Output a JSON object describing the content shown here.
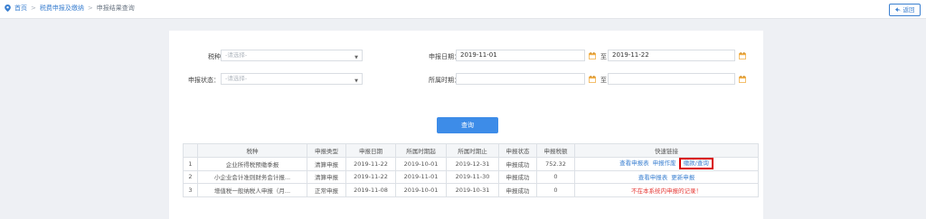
{
  "breadcrumb": {
    "home": "首页",
    "level1": "税费申报及缴纳",
    "current": "申报结果查询",
    "sep": ">"
  },
  "back_button": {
    "label": "返回"
  },
  "filters": {
    "tax_type": {
      "label": "税种：",
      "placeholder": "-请选择-"
    },
    "declare_status": {
      "label": "申报状态：",
      "placeholder": "-请选择-"
    },
    "declare_date": {
      "label": "申报日期：",
      "from": "2019-11-01",
      "to_label": "至",
      "to": "2019-11-22"
    },
    "belong_period": {
      "label": "所属时期：",
      "from": "",
      "to_label": "至",
      "to": ""
    }
  },
  "search_button": {
    "label": "查询"
  },
  "table": {
    "headers": [
      "",
      "税种",
      "申报类型",
      "申报日期",
      "所属时期起",
      "所属时期止",
      "申报状态",
      "申报税额",
      "快速链接"
    ],
    "rows": [
      {
        "index": "1",
        "tax": "企业所得税预缴季报",
        "type": "清算申报",
        "date": "2019-11-22",
        "start": "2019-10-01",
        "end": "2019-12-31",
        "status": "申报成功",
        "amount": "752.32",
        "links": [
          "查看申报表",
          "申报作废",
          "缴款/查询"
        ]
      },
      {
        "index": "2",
        "tax": "小企业会计准则财务会计报...",
        "type": "清算申报",
        "date": "2019-11-22",
        "start": "2019-11-01",
        "end": "2019-11-30",
        "status": "申报成功",
        "amount": "0",
        "links": [
          "查看申报表",
          "更新申报"
        ]
      },
      {
        "index": "3",
        "tax": "增值税一般纳税人申报（月...",
        "type": "正常申报",
        "date": "2019-11-08",
        "start": "2019-10-01",
        "end": "2019-10-31",
        "status": "申报成功",
        "amount": "0",
        "notice": "不在本系统内申报的记录！"
      }
    ]
  },
  "colors": {
    "accent": "#3d8ce8",
    "link": "#3a7fd0",
    "highlight_box": "#d90000",
    "warning_text": "#e53935",
    "calendar_icon": "#f2b04a"
  }
}
